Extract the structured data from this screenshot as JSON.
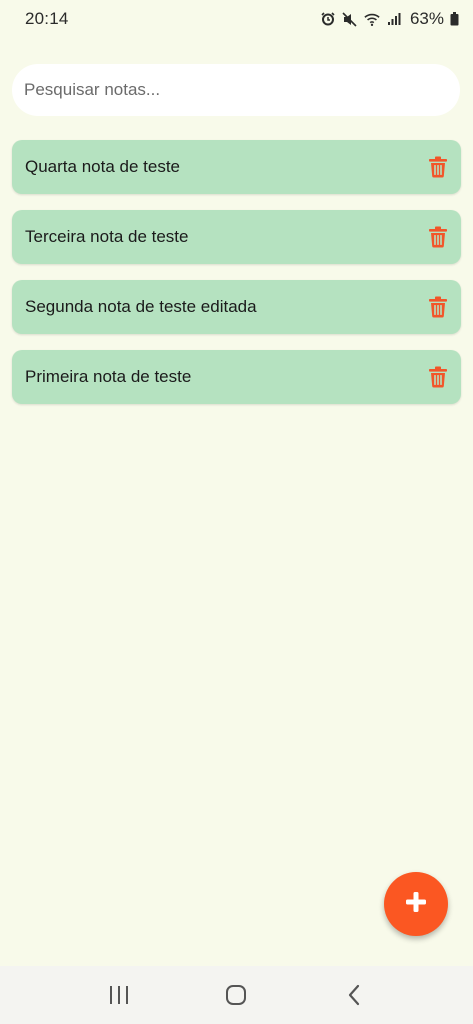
{
  "status_bar": {
    "time": "20:14",
    "battery_percent": "63%",
    "icons": [
      "alarm-icon",
      "mute-icon",
      "wifi-icon",
      "signal-icon",
      "battery-icon"
    ]
  },
  "search": {
    "placeholder": "Pesquisar notas...",
    "value": ""
  },
  "notes": [
    {
      "title": "Quarta nota de teste"
    },
    {
      "title": "Terceira nota de teste"
    },
    {
      "title": "Segunda nota de teste editada"
    },
    {
      "title": "Primeira nota de teste"
    }
  ],
  "note_action_icon": "trash-icon",
  "fab_icon": "plus-icon",
  "nav": [
    "recent-apps-icon",
    "home-icon",
    "back-icon"
  ],
  "colors": {
    "background": "#f8faea",
    "note_card": "#b5e2c0",
    "accent": "#fb5722",
    "delete_icon": "#f2562a"
  }
}
